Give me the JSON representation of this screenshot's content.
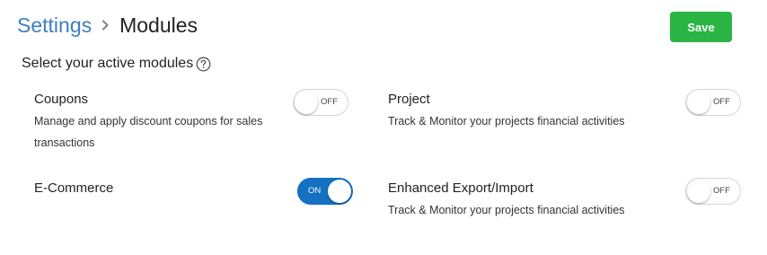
{
  "header": {
    "breadcrumb_parent": "Settings",
    "page_title": "Modules",
    "save_label": "Save"
  },
  "section": {
    "title": "Select your active modules"
  },
  "modules": [
    {
      "name": "Coupons",
      "description": "Manage and apply discount coupons for sales",
      "description_line2": "transactions",
      "toggle_label": "OFF",
      "enabled": false
    },
    {
      "name": "Project",
      "description": "Track & Monitor your projects financial activities",
      "toggle_label": "OFF",
      "enabled": false
    },
    {
      "name": "E-Commerce",
      "description": "",
      "toggle_label": "ON",
      "enabled": true
    },
    {
      "name": "Enhanced Export/Import",
      "description": "Track & Monitor your projects financial activities",
      "toggle_label": "OFF",
      "enabled": false
    }
  ],
  "icons": {
    "breadcrumb_separator": "chevron-right-icon",
    "help": "question-circle-icon"
  },
  "colors": {
    "link": "#3f7fbf",
    "save_button": "#2bb544",
    "toggle_on": "#1470c1"
  }
}
